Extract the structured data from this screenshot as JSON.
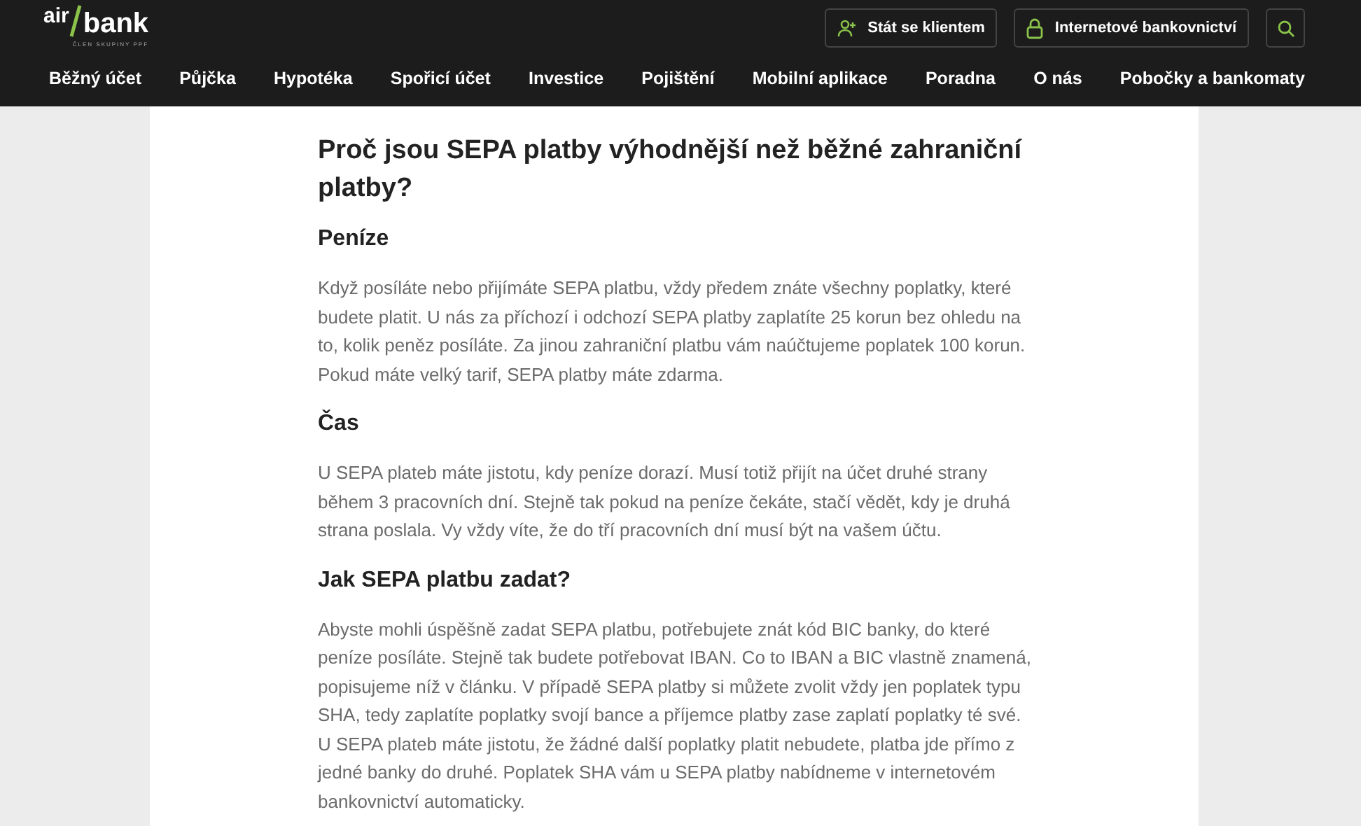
{
  "logo": {
    "top": "air",
    "main": "bank",
    "tagline": "ČLEN SKUPINY PPF"
  },
  "header_buttons": [
    {
      "kind": "user",
      "label": "Stát se klientem"
    },
    {
      "kind": "lock",
      "label": "Internetové bankovnictví"
    },
    {
      "kind": "search"
    }
  ],
  "nav": [
    "Běžný účet",
    "Půjčka",
    "Hypotéka",
    "Spořicí účet",
    "Investice",
    "Pojištění",
    "Mobilní aplikace",
    "Poradna",
    "O nás",
    "Pobočky a bankomaty"
  ],
  "article": {
    "title": "Proč jsou SEPA platby výhodnější než běžné zahraniční platby?",
    "sections": [
      {
        "heading": "Peníze",
        "paragraphs": [
          "Když posíláte nebo přijímáte SEPA platbu, vždy předem znáte všechny poplatky, které budete platit. U nás za příchozí i odchozí SEPA platby zaplatíte 25 korun bez ohledu na to, kolik peněz posíláte. Za jinou zahraniční platbu vám naúčtujeme poplatek 100 korun. Pokud máte velký tarif, SEPA platby máte zdarma."
        ]
      },
      {
        "heading": "Čas",
        "paragraphs": [
          "U SEPA plateb máte jistotu, kdy peníze dorazí. Musí totiž přijít na účet druhé strany během 3 pracovních dní. Stejně tak pokud na peníze čekáte, stačí vědět, kdy je druhá strana poslala. Vy vždy víte, že do tří pracovních dní musí být na vašem účtu."
        ]
      },
      {
        "heading": "Jak SEPA platbu zadat?",
        "paragraphs": [
          "Abyste mohli úspěšně zadat SEPA platbu, potřebujete znát kód BIC banky, do které peníze posíláte. Stejně tak budete potřebovat IBAN. Co to IBAN a BIC vlastně znamená, popisujeme níž v článku. V případě SEPA platby si můžete zvolit vždy jen poplatek typu SHA, tedy zaplatíte poplatky svojí bance a příjemce platby zase zaplatí poplatky té své.",
          "U SEPA plateb máte jistotu, že žádné další poplatky platit nebudete, platba jde přímo z jedné banky do druhé. Poplatek SHA vám u SEPA platby nabídneme v internetovém bankovnictví automaticky."
        ]
      }
    ]
  }
}
